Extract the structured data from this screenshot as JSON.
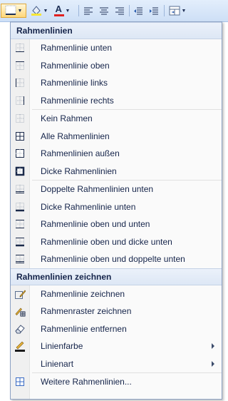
{
  "ribbon": {
    "buttons": [
      {
        "name": "borders-button",
        "icon": "borders-icon"
      },
      {
        "name": "shading-button",
        "icon": "shading-icon"
      },
      {
        "name": "font-color-button",
        "icon": "font-color-icon",
        "letter": "A"
      },
      {
        "name": "align-left-button",
        "icon": "align-left-icon"
      },
      {
        "name": "align-center-button",
        "icon": "align-center-icon"
      },
      {
        "name": "align-right-button",
        "icon": "align-right-icon"
      },
      {
        "name": "decrease-indent-button",
        "icon": "decrease-indent-icon"
      },
      {
        "name": "increase-indent-button",
        "icon": "increase-indent-icon"
      },
      {
        "name": "merge-button",
        "icon": "merge-icon"
      }
    ]
  },
  "menu": {
    "section1": "Rahmenlinien",
    "items1": [
      {
        "label": "Rahmenlinie unten",
        "icon": "border-bottom-icon"
      },
      {
        "label": "Rahmenlinie oben",
        "icon": "border-top-icon"
      },
      {
        "label": "Rahmenlinie links",
        "icon": "border-left-icon"
      },
      {
        "label": "Rahmenlinie rechts",
        "icon": "border-right-icon"
      }
    ],
    "items2": [
      {
        "label": "Kein Rahmen",
        "icon": "no-border-icon"
      },
      {
        "label": "Alle Rahmenlinien",
        "icon": "all-borders-icon"
      },
      {
        "label": "Rahmenlinien außen",
        "icon": "outside-borders-icon"
      },
      {
        "label": "Dicke Rahmenlinien",
        "icon": "thick-box-border-icon"
      }
    ],
    "items3": [
      {
        "label": "Doppelte Rahmenlinien unten",
        "icon": "double-bottom-border-icon"
      },
      {
        "label": "Dicke Rahmenlinie unten",
        "icon": "thick-bottom-border-icon"
      },
      {
        "label": "Rahmenlinie oben und unten",
        "icon": "top-bottom-border-icon"
      },
      {
        "label": "Rahmenlinie oben und dicke unten",
        "icon": "top-thick-bottom-border-icon"
      },
      {
        "label": "Rahmenlinie oben und doppelte unten",
        "icon": "top-double-bottom-border-icon"
      }
    ],
    "section2": "Rahmenlinien zeichnen",
    "items4": [
      {
        "label": "Rahmenlinie zeichnen",
        "icon": "draw-border-icon"
      },
      {
        "label": "Rahmenraster zeichnen",
        "icon": "draw-border-grid-icon"
      },
      {
        "label": "Rahmenlinie entfernen",
        "icon": "eraser-icon"
      },
      {
        "label": "Linienfarbe",
        "icon": "line-color-icon"
      },
      {
        "label": "Linienart",
        "icon": "line-style-icon"
      }
    ],
    "items5": [
      {
        "label": "Weitere Rahmenlinien...",
        "icon": "more-borders-icon"
      }
    ]
  }
}
